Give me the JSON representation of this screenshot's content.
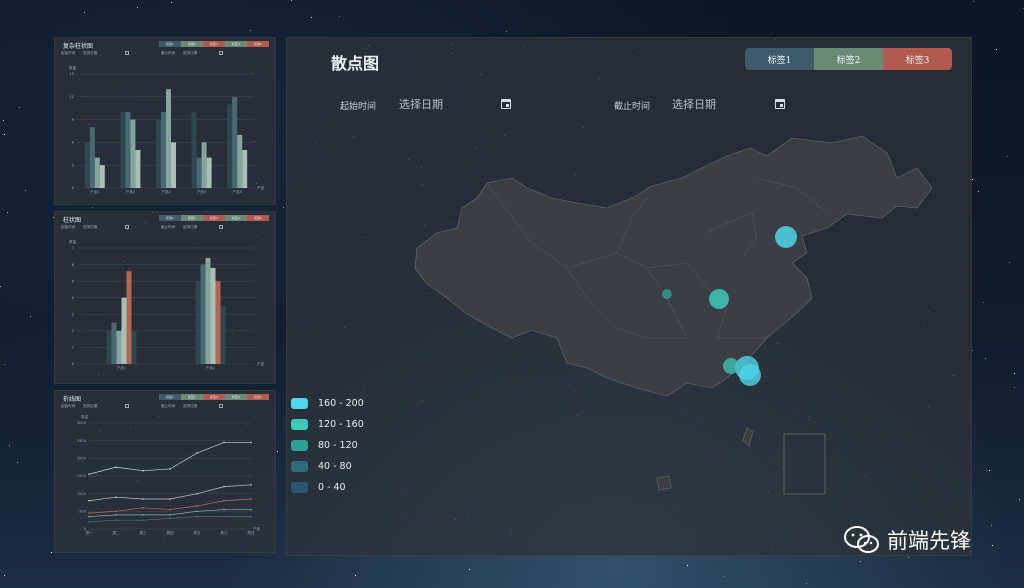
{
  "colors": {
    "tag1": "#3e5a6b",
    "tag2": "#6a8a76",
    "tag3": "#b15a4f",
    "teal_light": "#4fd6e8",
    "teal_mid": "#3fc8b8",
    "series_colors": [
      "#2e4a52",
      "#4d7078",
      "#8fb3a8",
      "#b7d0c4",
      "#c26e59"
    ]
  },
  "tags": [
    "标签1",
    "标签2",
    "标签3"
  ],
  "mini_tags": [
    "标签1",
    "标签2",
    "标签3",
    "标签4",
    "标签5"
  ],
  "date_picker": {
    "start_label": "起始时间",
    "end_label": "截止时间",
    "placeholder": "选择日期"
  },
  "mini_date_picker": {
    "start_label": "起始时间",
    "end_label": "截止时间",
    "placeholder": "选择日期"
  },
  "panel1": {
    "title": "复杂柱状图",
    "chart_data": {
      "type": "bar",
      "ylabel": "数量",
      "xlabel": "产品",
      "ylim": [
        0,
        15
      ],
      "yticks": [
        0,
        3,
        6,
        9,
        12,
        15
      ],
      "categories": [
        "产品1",
        "产品2",
        "产品3",
        "产品4",
        "产品5"
      ],
      "series": [
        {
          "values": [
            6,
            10,
            9,
            10,
            11
          ]
        },
        {
          "values": [
            8,
            10,
            10,
            4,
            12
          ]
        },
        {
          "values": [
            4,
            9,
            13,
            6,
            7
          ]
        },
        {
          "values": [
            3,
            5,
            6,
            4,
            5
          ]
        }
      ]
    }
  },
  "panel2": {
    "title": "柱状图",
    "chart_data": {
      "type": "bar",
      "ylabel": "数量",
      "xlabel": "产品",
      "ylim": [
        0,
        7
      ],
      "yticks": [
        0,
        1,
        2,
        3,
        4,
        5,
        6,
        7
      ],
      "categories": [
        "产品1",
        "产品2"
      ],
      "series": [
        {
          "values": [
            2,
            5
          ]
        },
        {
          "values": [
            2.5,
            6
          ]
        },
        {
          "values": [
            2,
            6.4
          ]
        },
        {
          "values": [
            4,
            5.8
          ]
        },
        {
          "values": [
            5.6,
            5
          ]
        },
        {
          "values": [
            2,
            3.5
          ]
        }
      ]
    }
  },
  "panel3": {
    "title": "折线图",
    "chart_data": {
      "type": "line",
      "ylabel": "数量",
      "xlabel": "产品",
      "ylim": [
        0,
        3000
      ],
      "yticks": [
        0,
        500,
        1000,
        1500,
        2000,
        2500,
        3000
      ],
      "categories": [
        "周一",
        "周二",
        "周三",
        "周四",
        "周五",
        "周六",
        "周日"
      ],
      "series": [
        {
          "values": [
            1550,
            1750,
            1650,
            1700,
            2150,
            2450,
            2450
          ]
        },
        {
          "values": [
            800,
            900,
            850,
            850,
            1000,
            1200,
            1250
          ]
        },
        {
          "values": [
            450,
            500,
            600,
            550,
            650,
            800,
            850
          ]
        },
        {
          "values": [
            350,
            400,
            400,
            400,
            500,
            550,
            550
          ]
        },
        {
          "values": [
            200,
            250,
            250,
            300,
            350,
            350,
            350
          ]
        }
      ]
    }
  },
  "map_panel": {
    "title": "散点图",
    "legend": [
      {
        "label": "160 - 200",
        "color": "#4fd6e8"
      },
      {
        "label": "120 - 160",
        "color": "#3fc8b8"
      },
      {
        "label": "80 - 120",
        "color": "#2f9f97"
      },
      {
        "label": "40 - 80",
        "color": "#2b6e79"
      },
      {
        "label": "0 - 40",
        "color": "#2a5574"
      }
    ]
  },
  "watermark": "前端先锋"
}
